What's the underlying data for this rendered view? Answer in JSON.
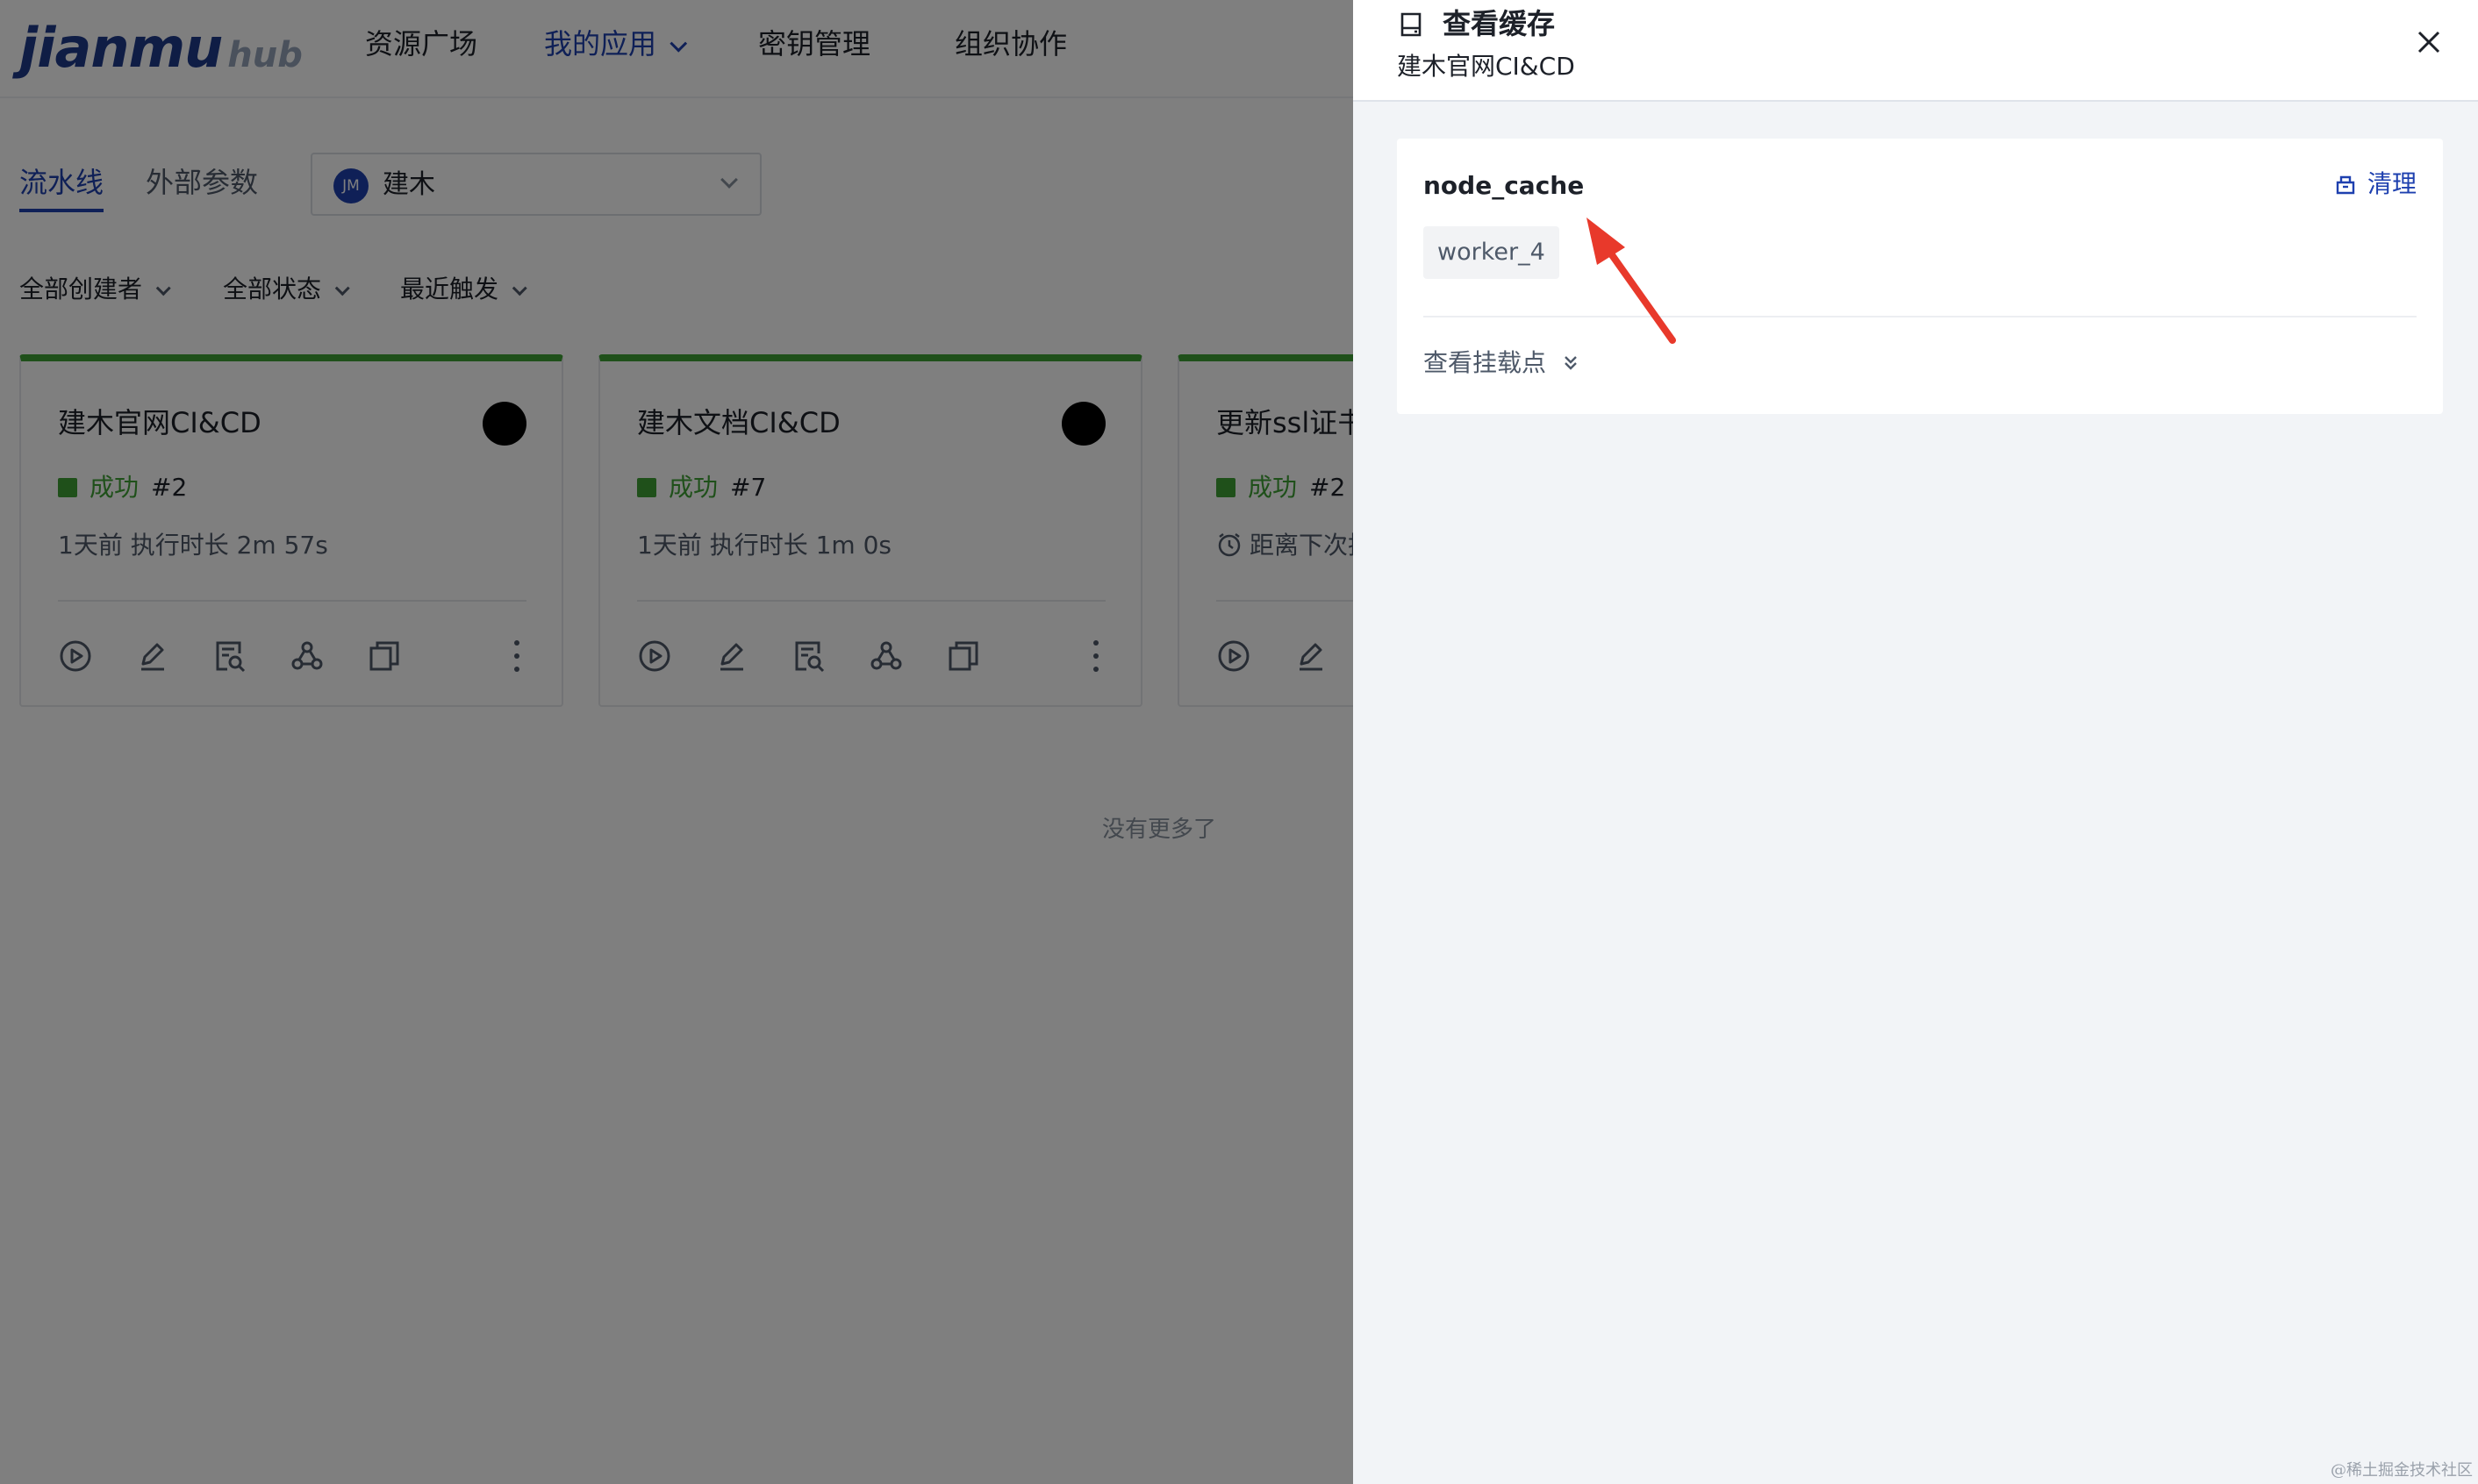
{
  "nav": {
    "logo_main": "jianmu",
    "logo_sub": "hub",
    "items": [
      "资源广场",
      "我的应用",
      "密钥管理",
      "组织协作"
    ]
  },
  "tabs": [
    "流水线",
    "外部参数"
  ],
  "org_select": {
    "avatar": "JM",
    "name": "建木"
  },
  "filters": [
    "全部创建者",
    "全部状态",
    "最近触发"
  ],
  "cards": [
    {
      "title": "建木官网CI&CD",
      "status": "成功",
      "run": "#2",
      "meta": "1天前   执行时长 2m 57s"
    },
    {
      "title": "建木文档CI&CD",
      "status": "成功",
      "run": "#7",
      "meta": "1天前   执行时长 1m 0s"
    },
    {
      "title": "更新ssl证书",
      "status": "成功",
      "run": "#2",
      "meta": "距离下次执行"
    }
  ],
  "no_more": "没有更多了",
  "drawer": {
    "title": "查看缓存",
    "subtitle": "建木官网CI&CD",
    "cache": {
      "name": "node_cache",
      "clear_label": "清理",
      "tag": "worker_4",
      "mount_label": "查看挂载点"
    }
  },
  "watermark": "@稀土掘金技术社区",
  "colors": {
    "accent": "#1e40af",
    "success": "#3ea134",
    "annotation_arrow": "#e8392b"
  }
}
